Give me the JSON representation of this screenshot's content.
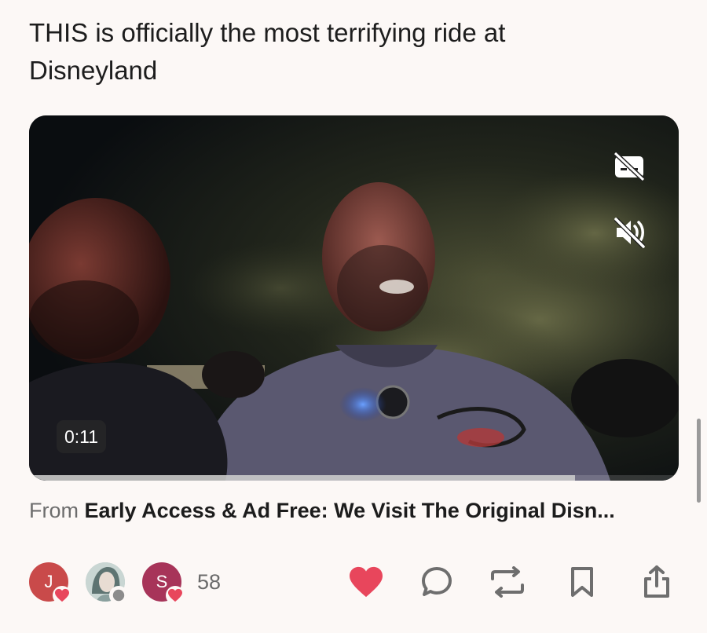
{
  "post": {
    "title": "THIS is officially the most terrifying ride at Disneyland"
  },
  "video": {
    "timestamp": "0:11",
    "progress": 0.84,
    "controls": {
      "captions_icon": "captions-off-icon",
      "mute_icon": "volume-muted-icon"
    }
  },
  "source": {
    "prefix": "From",
    "name": "Early Access & Ad Free: We Visit The Original Disn..."
  },
  "engagement": {
    "avatars": [
      {
        "initial": "J",
        "color": "#c94a4a",
        "badge": "heart-icon"
      },
      {
        "initial": "",
        "color": "#b7c8c6",
        "badge": "comment-icon"
      },
      {
        "initial": "S",
        "color": "#a73459",
        "badge": "heart-icon"
      }
    ],
    "like_count": "58",
    "like_color": "#e8465c"
  },
  "actions": [
    "heart-icon",
    "comment-icon",
    "restack-icon",
    "bookmark-icon",
    "share-icon"
  ]
}
